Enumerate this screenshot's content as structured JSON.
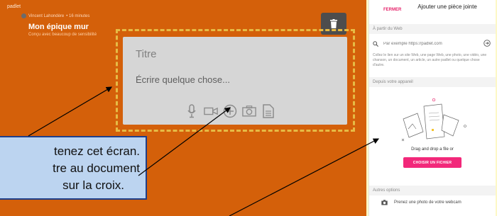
{
  "board": {
    "app_label": "padlet",
    "author": "Vincent Lahondère",
    "time_ago": "• 16 minutes",
    "title": "Mon épique mur",
    "subtitle": "Conçu avec beaucoup de sensibilité"
  },
  "post": {
    "title_placeholder": "Titre",
    "body_placeholder": "Écrire quelque chose..."
  },
  "callout": {
    "lines": [
      "tenez cet écran.",
      "tre au document",
      "sur la croix."
    ]
  },
  "panel": {
    "close_label": "FERMER",
    "title": "Ajouter une pièce jointe",
    "web_section": "À partir du Web",
    "url_placeholder": "Par exemple https://padlet.com",
    "help_text": "Collez le lien sur un site Web, une page Web, une photo, une vidéo, une chanson, un document, un article, un autre padlet ou quelque chose d'autre.",
    "device_section": "Depuis votre appareil",
    "drag_text": "Drag and drop a file or",
    "choose_button": "CHOISIR UN FICHIER",
    "other_section": "Autres options",
    "webcam_option": "Prenez une photo de votre webcam"
  },
  "colors": {
    "board_bg": "#d4600a",
    "accent": "#f2287a",
    "callout_bg": "#bcd4f0",
    "callout_border": "#1f3f8a",
    "dashed_frame": "#e6bb45"
  }
}
